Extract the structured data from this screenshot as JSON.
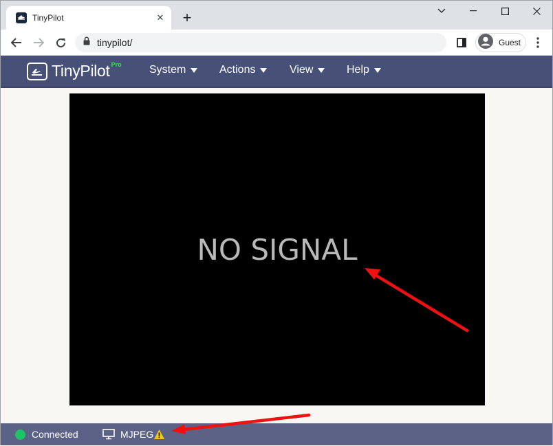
{
  "browser": {
    "tab_title": "TinyPilot",
    "tab_close_glyph": "✕",
    "new_tab_glyph": "+",
    "address": "tinypilot/",
    "profile_label": "Guest"
  },
  "app_nav": {
    "logo_text": "TinyPilot",
    "logo_badge": "Pro",
    "menus": [
      "System",
      "Actions",
      "View",
      "Help"
    ]
  },
  "remote_screen": {
    "message": "NO SIGNAL"
  },
  "status_bar": {
    "connection_status": "Connected",
    "stream_mode": "MJPEG",
    "connected_color": "#1fc367",
    "warning_color": "#f5c518"
  },
  "colors": {
    "navbar": "#475178",
    "statusbar": "#5c6285",
    "annotation": "#ee1111"
  },
  "icons": [
    "tinypilot-favicon",
    "close-icon",
    "plus-icon",
    "minimize-icon",
    "chevron-down-icon",
    "maximize-icon",
    "window-close-icon",
    "back-arrow-icon",
    "forward-arrow-icon",
    "reload-icon",
    "lock-icon",
    "side-panel-icon",
    "profile-avatar-icon",
    "kebab-menu-icon",
    "tinypilot-logo-icon",
    "monitor-icon",
    "warning-icon"
  ]
}
